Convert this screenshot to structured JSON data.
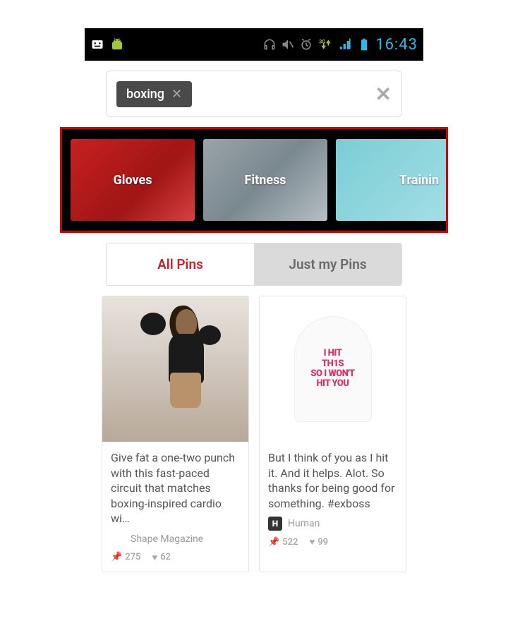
{
  "status_bar": {
    "time": "16:43",
    "network_label": "3G"
  },
  "search": {
    "chip_label": "boxing"
  },
  "categories": [
    {
      "label": "Gloves"
    },
    {
      "label": "Fitness"
    },
    {
      "label": "Trainin"
    }
  ],
  "tabs": {
    "all_pins": "All Pins",
    "my_pins": "Just my Pins"
  },
  "pins": [
    {
      "description": "Give fat a one-two punch with this fast-paced circuit that matches boxing-inspired cardio wi…",
      "source": "Shape Magazine",
      "pin_count": "275",
      "like_count": "62",
      "image_kind": "boxer"
    },
    {
      "description": "But I think of you as I hit it.  And it helps.  Alot.  So thanks for being good for something. #exboss",
      "source": "Human",
      "pin_count": "522",
      "like_count": "99",
      "image_kind": "tank",
      "tank_text": "I HIT\nTH1S\nSO I WON'T\nHIT YOU"
    }
  ]
}
